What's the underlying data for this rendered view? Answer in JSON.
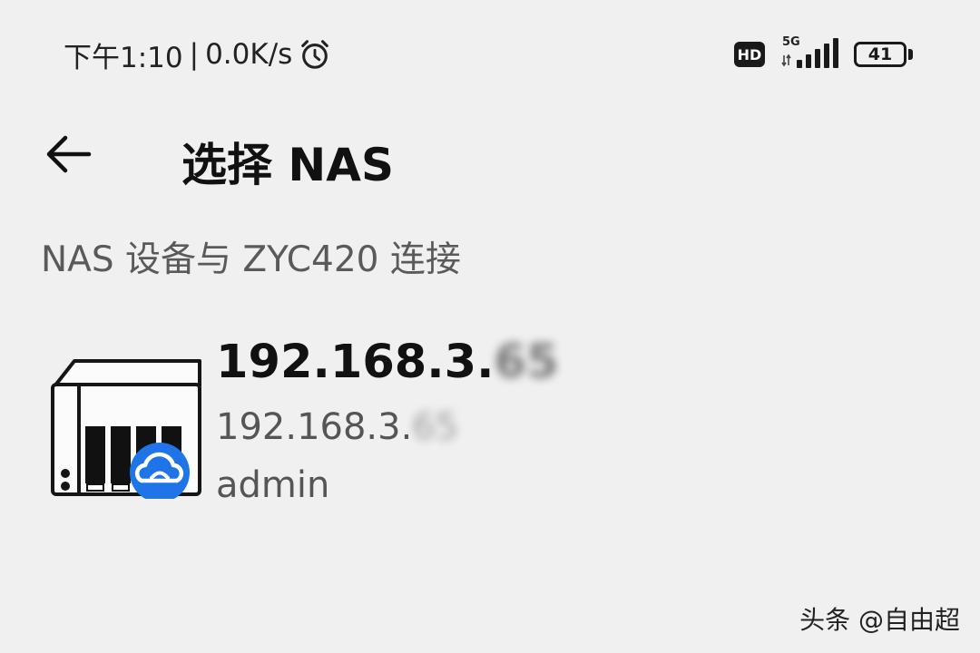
{
  "status_bar": {
    "time": "下午1:10",
    "separator": "|",
    "speed": "0.0K/s",
    "hd_label": "HD",
    "network_label": "5G",
    "battery_level": "41",
    "icons": [
      "alarm-clock-icon",
      "hd-icon",
      "signal-icon",
      "battery-icon"
    ]
  },
  "header": {
    "back_icon": "arrow-left-icon",
    "title": "选择 NAS"
  },
  "section": {
    "label": "NAS 设备与 ZYC420 连接"
  },
  "nas_list": [
    {
      "name_prefix": "192.168.3.",
      "name_suffix_blurred": "65",
      "ip_prefix": "192.168.3.",
      "ip_suffix_blurred": "65",
      "username": "admin",
      "icon": "nas-device-icon",
      "badge_icon": "cloud-icon",
      "badge_color": "#1f74e8"
    }
  ],
  "watermark": "头条 @自由超"
}
